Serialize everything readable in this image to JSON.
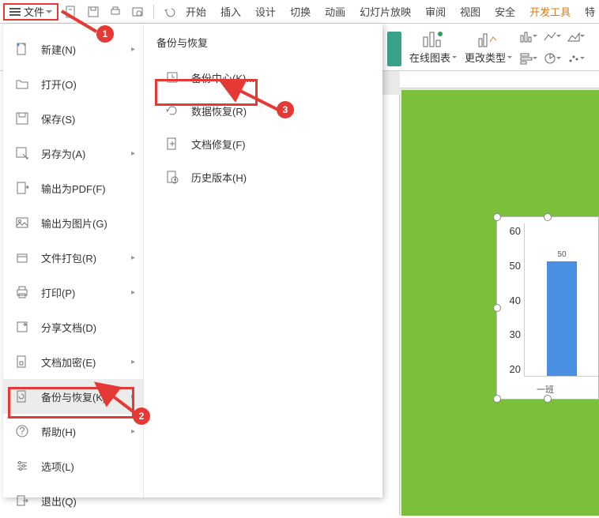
{
  "toolbar": {
    "file_label": "文件",
    "tabs": [
      "开始",
      "插入",
      "设计",
      "切换",
      "动画",
      "幻灯片放映",
      "审阅",
      "视图",
      "安全",
      "开发工具",
      "特"
    ]
  },
  "ribbon": {
    "group1_label": "在线图表",
    "group2_label": "更改类型"
  },
  "menu": {
    "items": [
      {
        "label": "新建(N)",
        "arrow": true
      },
      {
        "label": "打开(O)",
        "arrow": false
      },
      {
        "label": "保存(S)",
        "arrow": false
      },
      {
        "label": "另存为(A)",
        "arrow": true
      },
      {
        "label": "输出为PDF(F)",
        "arrow": false
      },
      {
        "label": "输出为图片(G)",
        "arrow": false
      },
      {
        "label": "文件打包(R)",
        "arrow": true
      },
      {
        "label": "打印(P)",
        "arrow": true
      },
      {
        "label": "分享文档(D)",
        "arrow": false
      },
      {
        "label": "文档加密(E)",
        "arrow": true
      },
      {
        "label": "备份与恢复(K)",
        "arrow": true
      },
      {
        "label": "帮助(H)",
        "arrow": true
      },
      {
        "label": "选项(L)",
        "arrow": false
      },
      {
        "label": "退出(Q)",
        "arrow": false
      }
    ],
    "col2_title": "备份与恢复",
    "sub_items": [
      {
        "label": "备份中心(K)..."
      },
      {
        "label": "数据恢复(R)"
      },
      {
        "label": "文档修复(F)"
      },
      {
        "label": "历史版本(H)"
      }
    ]
  },
  "annotations": {
    "b1": "1",
    "b2": "2",
    "b3": "3"
  },
  "chart_data": {
    "type": "bar",
    "categories": [
      "一班"
    ],
    "values": [
      50
    ],
    "value_labels": [
      "50"
    ],
    "y_ticks": [
      "60",
      "50",
      "40",
      "30",
      "20"
    ],
    "ylim": [
      0,
      60
    ],
    "xlabel": "一班"
  }
}
